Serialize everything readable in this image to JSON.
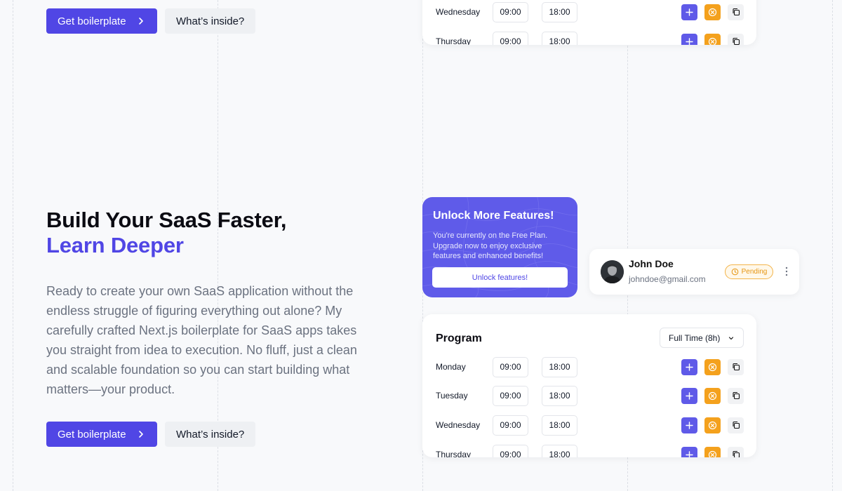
{
  "hero": {
    "title_line1": "Build Your SaaS Faster,",
    "title_line2": "Learn Deeper",
    "description": "Ready to create your own SaaS application without the endless struggle of figuring everything out alone? My carefully crafted Next.js boilerplate for SaaS apps takes you straight from idea to execution. No fluff, just a clean and scalable foundation so you can start building what matters—your product.",
    "primary_button": "Get boilerplate",
    "secondary_button": "What’s inside?"
  },
  "top_buttons": {
    "primary": "Get boilerplate",
    "secondary": "What’s inside?"
  },
  "top_schedule": {
    "rows": [
      {
        "day": "Wednesday",
        "start": "09:00",
        "end": "18:00"
      },
      {
        "day": "Thursday",
        "start": "09:00",
        "end": "18:00"
      }
    ]
  },
  "unlock": {
    "title": "Unlock More Features!",
    "text": "You're currently on the Free Plan. Upgrade now to enjoy exclusive features and enhanced benefits!",
    "button": "Unlock features!"
  },
  "user": {
    "name": "John Doe",
    "email": "johndoe@gmail.com",
    "status": "Pending"
  },
  "program": {
    "title": "Program",
    "select_value": "Full Time (8h)",
    "rows": [
      {
        "day": "Monday",
        "start": "09:00",
        "end": "18:00"
      },
      {
        "day": "Tuesday",
        "start": "09:00",
        "end": "18:00"
      },
      {
        "day": "Wednesday",
        "start": "09:00",
        "end": "18:00"
      },
      {
        "day": "Thursday",
        "start": "09:00",
        "end": "18:00"
      }
    ]
  },
  "colors": {
    "accent": "#5046e5",
    "add_button": "#5f5ae8",
    "cancel_button": "#f4a11d",
    "pending": "#e69512"
  }
}
